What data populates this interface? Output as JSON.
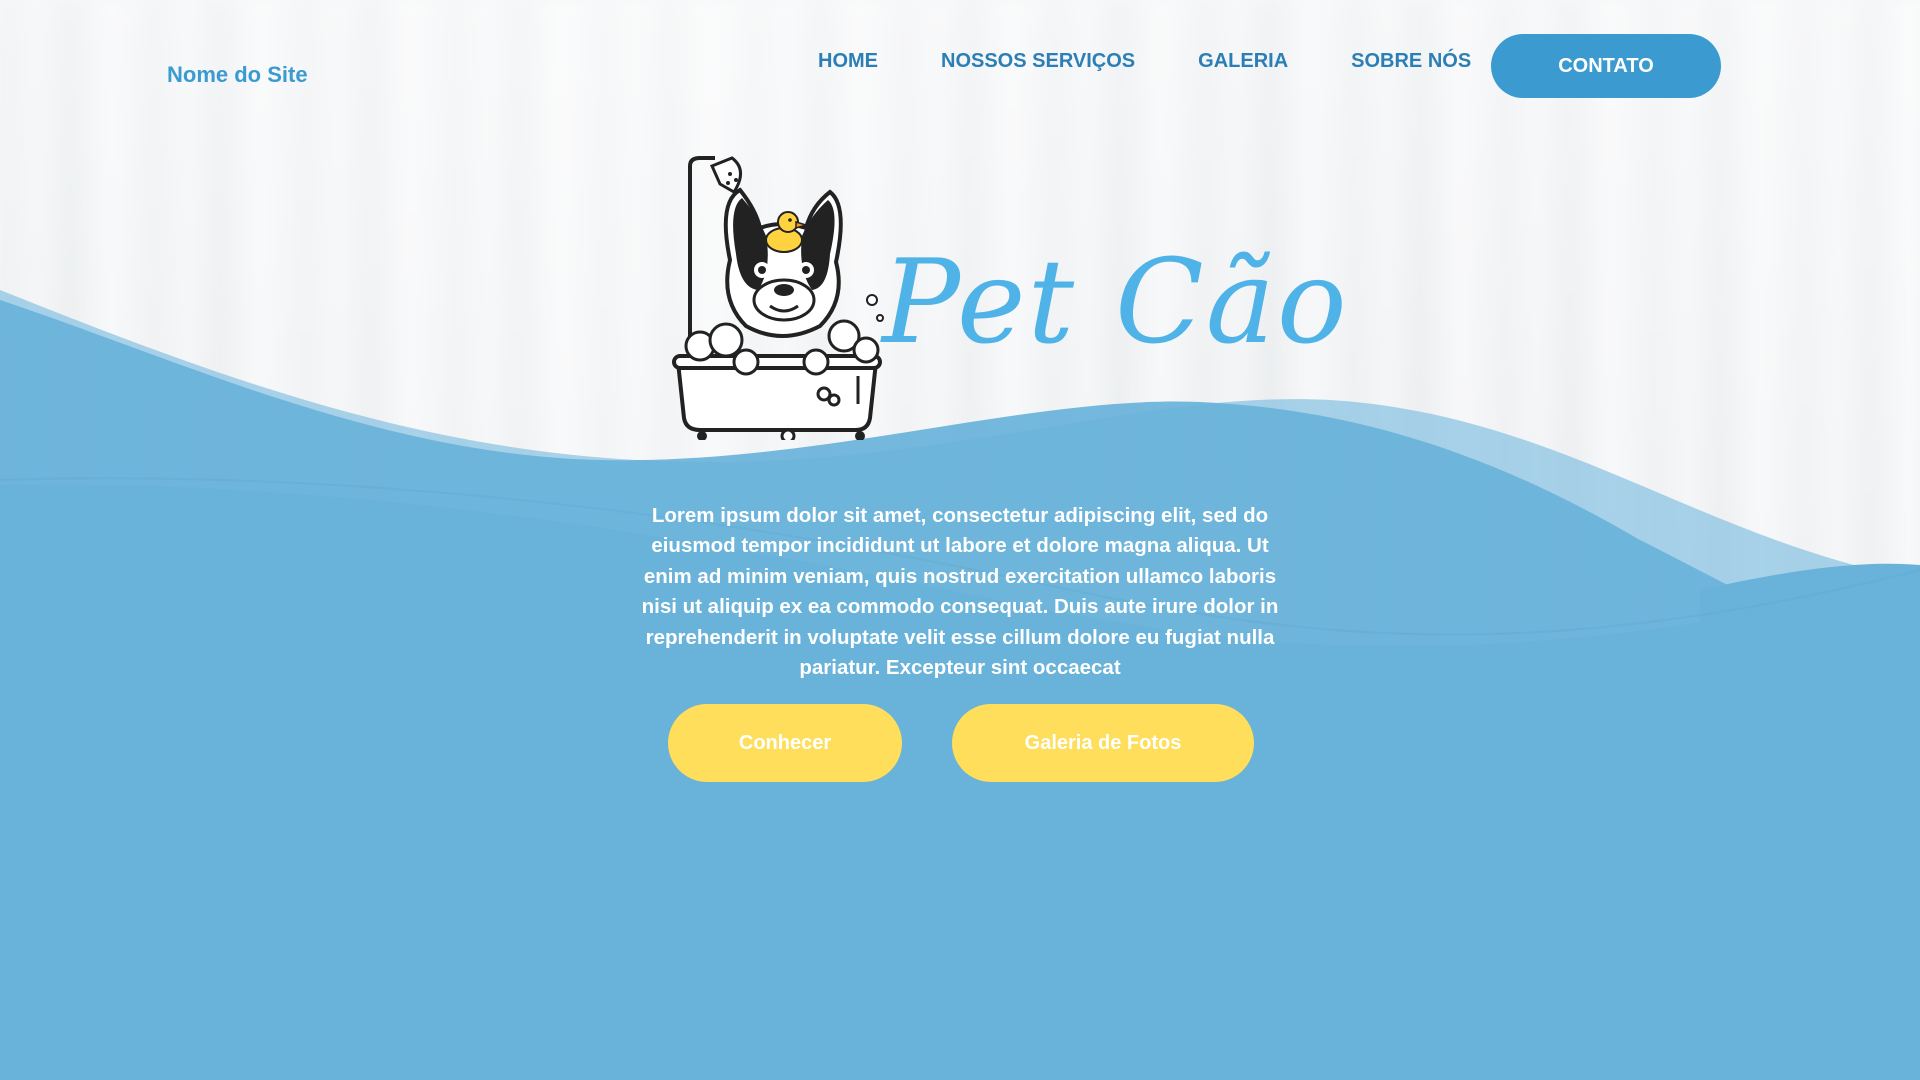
{
  "header": {
    "site_name": "Nome do Site",
    "nav": [
      {
        "label": "HOME"
      },
      {
        "label": "NOSSOS SERVIÇOS"
      },
      {
        "label": "GALERIA"
      },
      {
        "label": "SOBRE NÓS"
      }
    ],
    "contact_label": "CONTATO"
  },
  "hero": {
    "logo_text": "Pet Cão",
    "description": "Lorem ipsum dolor sit amet, consectetur adipiscing elit, sed do eiusmod tempor incididunt ut labore et dolore magna aliqua. Ut enim ad minim veniam, quis nostrud exercitation ullamco laboris nisi ut aliquip ex ea commodo consequat. Duis aute irure dolor in reprehenderit in voluptate velit esse cillum dolore eu fugiat nulla pariatur. Excepteur sint occaecat",
    "buttons": {
      "primary_label": "Conhecer",
      "secondary_label": "Galeria de Fotos"
    }
  },
  "colors": {
    "brand_blue": "#3b9bd0",
    "wave_blue": "#69b2da",
    "logo_blue": "#4fb3e8",
    "button_yellow": "#ffde5b"
  },
  "icons": {
    "logo_mascot": "dog-in-bathtub-with-rubber-duck-icon"
  }
}
